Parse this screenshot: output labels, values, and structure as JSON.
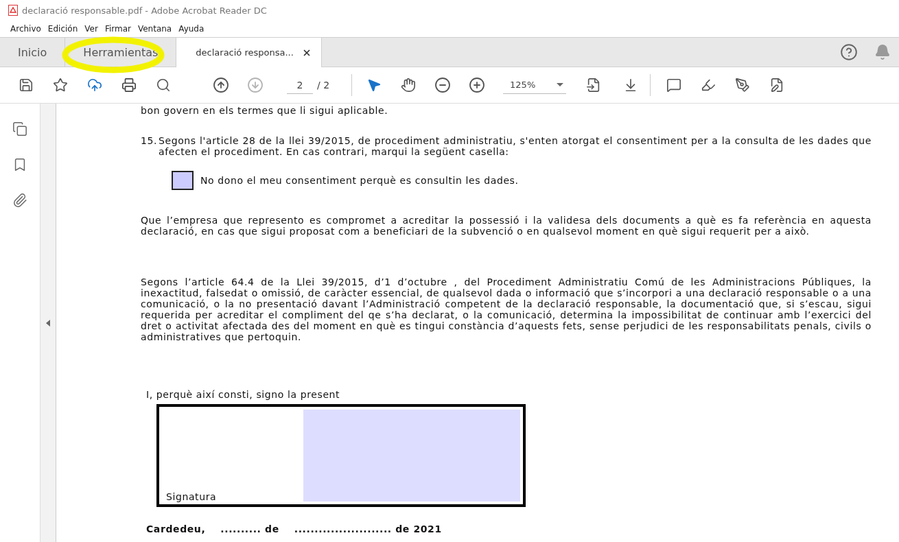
{
  "window": {
    "title": "declaració responsable.pdf - Adobe Acrobat Reader DC"
  },
  "menu": [
    "Archivo",
    "Edición",
    "Ver",
    "Firmar",
    "Ventana",
    "Ayuda"
  ],
  "tabs": [
    {
      "label": "Inicio",
      "selected": false,
      "closable": false
    },
    {
      "label": "Herramientas",
      "selected": false,
      "closable": false
    },
    {
      "label": "declaració responsa...",
      "selected": true,
      "closable": true
    }
  ],
  "toolbar": {
    "nav": [
      {
        "kind": "prev",
        "disabled": false
      },
      {
        "kind": "next",
        "disabled": true
      }
    ],
    "page_current": "2",
    "page_total": "/ 2",
    "tools": [
      {
        "kind": "select",
        "selected": true
      },
      {
        "kind": "hand",
        "selected": false
      }
    ],
    "zoom": "125%"
  },
  "document": {
    "blocks": [
      {
        "kind": "text",
        "text": "bon govern en els termes que li sigui aplicable."
      },
      {
        "kind": "numbered",
        "number": "15.",
        "text": "Segons l'article 28 de la llei 39/2015, de procediment administratiu, s'enten  atorgat el consentiment per a la consulta de les dades que afecten el procediment. En cas contrari, marqui la següent casella:"
      },
      {
        "kind": "checkbox",
        "checked": false,
        "text": "No dono el meu consentiment perquè es consultin les dades."
      },
      {
        "kind": "text",
        "text": "Que l’empresa que represento es compromet a acreditar la possessió i la validesa dels documents a què es fa referència en aquesta declaració, en cas que sigui proposat com a beneficiari de la subvenció o en qualsevol moment en què sigui requerit per a això."
      },
      {
        "kind": "text",
        "text": "Segons l’article 64.4 de la Llei 39/2015, d’1 d’octubre , del Procediment Administratiu Comú de les Administracions Públiques, la inexactitud, falsedat o omissió, de caràcter essencial, de qualsevol dada o informació que s’incorpori a una declaració responsable o a una comunicació, o la no presentació davant l’Administració competent de la declaració responsable, la documentació que, si s’escau, sigui requerida per acreditar el compliment del qe s’ha declarat, o la comunicació, determina la impossibilitat de continuar amb l’exercici del dret o activitat afectada des del moment en què es tingui constància d’aquests fets, sense perjudici de les responsabilitats penals, civils o administratives que pertoquin."
      }
    ],
    "signature": {
      "intro": "I, perquè així consti, signo la present",
      "label": "Signatura"
    },
    "place_line": [
      "Cardedeu,",
      ".......... de",
      "........................ de 2021"
    ]
  }
}
